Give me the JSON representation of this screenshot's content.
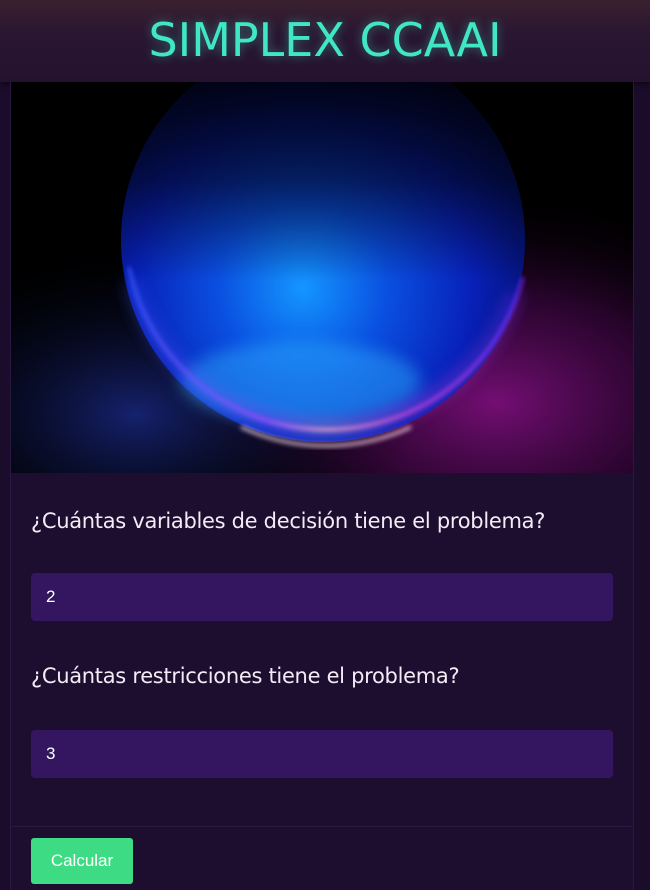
{
  "header": {
    "title": "SIMPLEX CCAAI"
  },
  "hero": {
    "image": "glowing-orb-illustration",
    "colors": {
      "blue": "#1a3cff",
      "cyan": "#19a6ff",
      "magenta": "#b21fd6",
      "pink": "#ff7ab8"
    }
  },
  "form": {
    "q_variables_label": "¿Cuántas variables de decisión tiene el problema?",
    "q_variables_value": "2",
    "q_constraints_label": "¿Cuántas restricciones tiene el problema?",
    "q_constraints_value": "3",
    "submit_label": "Calcular"
  },
  "colors": {
    "accent": "#41e6c4",
    "button": "#3ddc84",
    "input_bg": "#33165f",
    "page_bg": "#1b0c2b"
  }
}
